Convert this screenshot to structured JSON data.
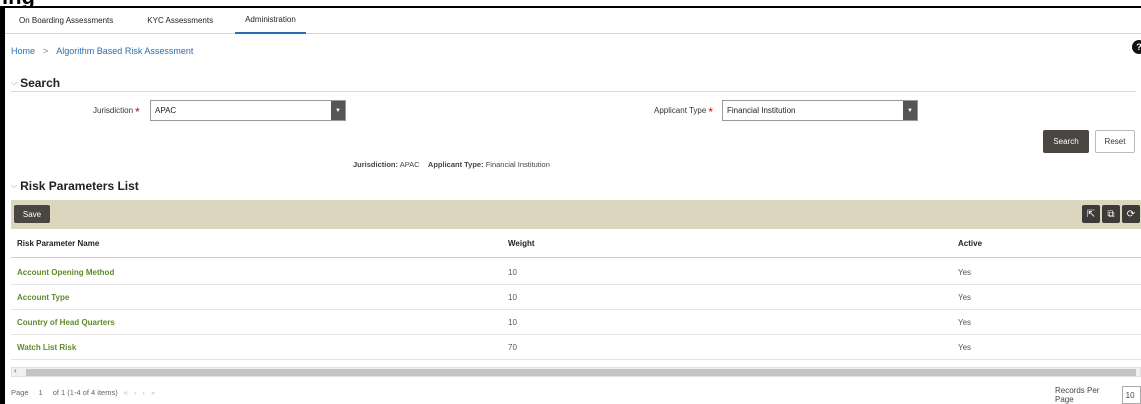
{
  "header_fragment": "ing",
  "tabs": [
    {
      "label": "On Boarding Assessments",
      "active": false
    },
    {
      "label": "KYC Assessments",
      "active": false
    },
    {
      "label": "Administration",
      "active": true
    }
  ],
  "breadcrumb": {
    "home": "Home",
    "separator": ">",
    "current": "Algorithm Based Risk Assessment"
  },
  "search": {
    "title": "Search",
    "jurisdiction_label": "Jurisdiction",
    "jurisdiction_value": "APAC",
    "applicant_type_label": "Applicant Type",
    "applicant_type_value": "Financial Institution",
    "required_marker": "*",
    "search_button": "Search",
    "reset_button": "Reset"
  },
  "summary": {
    "jurisdiction_label": "Jurisdiction:",
    "jurisdiction_value": "APAC",
    "applicant_type_label": "Applicant Type:",
    "applicant_type_value": "Financial Institution"
  },
  "risk_list": {
    "title": "Risk Parameters List",
    "save_button": "Save",
    "columns": [
      "Risk Parameter Name",
      "Weight",
      "Active"
    ],
    "rows": [
      {
        "name": "Account Opening Method",
        "weight": "10",
        "active": "Yes"
      },
      {
        "name": "Account Type",
        "weight": "10",
        "active": "Yes"
      },
      {
        "name": "Country of Head Quarters",
        "weight": "10",
        "active": "Yes"
      },
      {
        "name": "Watch List Risk",
        "weight": "70",
        "active": "Yes"
      }
    ]
  },
  "pagination": {
    "page_label": "Page",
    "page_number": "1",
    "page_info": "of 1 (1-4 of 4 items)",
    "records_per_page_label": "Records Per Page",
    "records_per_page_value": "10"
  },
  "colors": {
    "accent": "#2a6db3",
    "link_green": "#5b8c2a",
    "toolbar_bg": "#ddd6bf",
    "button_dark": "#4a4642"
  }
}
